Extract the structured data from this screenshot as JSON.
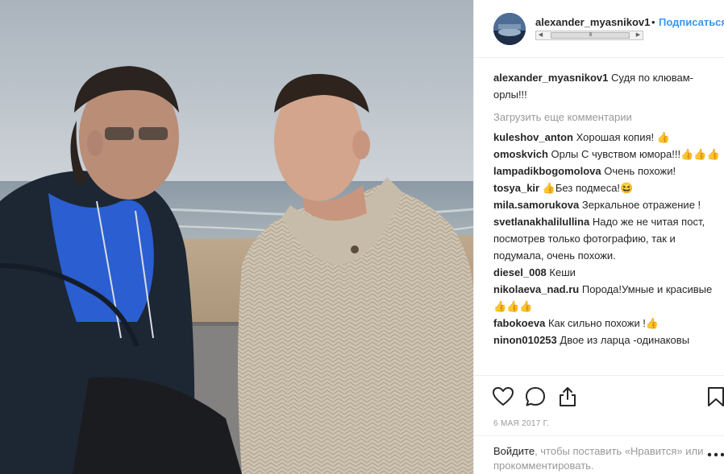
{
  "post": {
    "photo_alt": "",
    "date": "6 МАЯ 2017 Г."
  },
  "header": {
    "username": "alexander_myasnikov1",
    "separator": "•",
    "follow_label": "Подписаться",
    "scroll_left": "◀",
    "scroll_right": "▶",
    "scroll_grip": "III"
  },
  "caption": {
    "user": "alexander_myasnikov1",
    "text": "Судя по клювам-орлы!!!"
  },
  "load_more": "Загрузить еще комментарии",
  "comments": [
    {
      "user": "kuleshov_anton",
      "text": "Хорошая копия! 👍"
    },
    {
      "user": "omoskvich",
      "text": "Орлы С чувством юмора!!!👍👍👍"
    },
    {
      "user": "lampadikbogomolova",
      "text": "Очень похожи!"
    },
    {
      "user": "tosya_kir",
      "text": "👍Без подмеса!😆"
    },
    {
      "user": "mila.samorukova",
      "text": "Зеркальное отражение !"
    },
    {
      "user": "svetlanakhalilullina",
      "text": "Надо же не читая пост, посмотрев только фотографию, так и подумала, очень похожи."
    },
    {
      "user": "diesel_008",
      "text": "Кеши"
    },
    {
      "user": "nikolaeva_nad.ru",
      "text": "Порода!Умные и красивые👍👍👍"
    },
    {
      "user": "fabokoeva",
      "text": "Как сильно похожи !👍"
    },
    {
      "user": "ninon010253",
      "text": "Двое из ларца -одинаковы"
    }
  ],
  "login": {
    "link": "Войдите",
    "rest": ", чтобы поставить «Нравится» или прокомментировать."
  },
  "icons": {
    "like": "heart-icon",
    "comment": "comment-icon",
    "share": "share-icon",
    "save": "bookmark-icon",
    "more": "more-dots-icon"
  },
  "colors": {
    "link_blue": "#3897f0",
    "text": "#262626",
    "muted": "#999999"
  }
}
